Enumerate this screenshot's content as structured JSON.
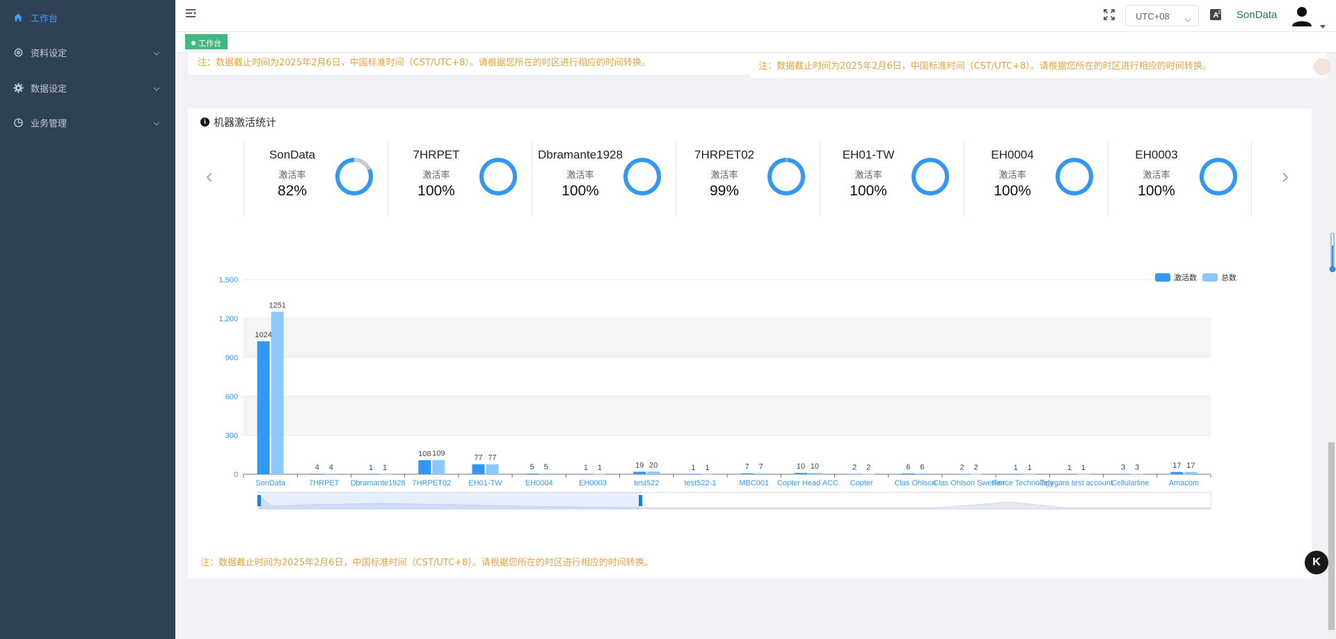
{
  "sidebar": {
    "items": [
      {
        "label": "工作台",
        "icon": "home-icon",
        "active": true
      },
      {
        "label": "资料设定",
        "icon": "settings-icon"
      },
      {
        "label": "数据设定",
        "icon": "gear-icon"
      },
      {
        "label": "业务管理",
        "icon": "pie-chart-icon"
      }
    ]
  },
  "header": {
    "timezone": "UTC+08",
    "username": "SonData"
  },
  "tags": {
    "active": "工作台"
  },
  "notes": {
    "text": "注：数据截止时间为2025年2月6日，中国标准时间（CST/UTC+8）。请根据您所在的时区进行相应的时间转换。"
  },
  "activation": {
    "title": "机器激活统计",
    "rate_label": "激活率",
    "cards": [
      {
        "name": "SonData",
        "value": "82%",
        "rate": 0.82
      },
      {
        "name": "7HRPET",
        "value": "100%",
        "rate": 1.0
      },
      {
        "name": "Dbramante1928",
        "value": "100%",
        "rate": 1.0
      },
      {
        "name": "7HRPET02",
        "value": "99%",
        "rate": 0.99
      },
      {
        "name": "EH01-TW",
        "value": "100%",
        "rate": 1.0
      },
      {
        "name": "EH0004",
        "value": "100%",
        "rate": 1.0
      },
      {
        "name": "EH0003",
        "value": "100%",
        "rate": 1.0
      }
    ]
  },
  "colors": {
    "activated": "#3398f3",
    "total": "#8cc8fa",
    "ring_bg": "#c8ccd2",
    "note": "#e6a23c",
    "accent": "#409eff",
    "tag": "#42b983"
  },
  "chart_data": {
    "type": "bar",
    "categories": [
      "SonData",
      "7HRPET",
      "Dbramante1928",
      "7HRPET02",
      "EH01-TW",
      "EH0004",
      "EH0003",
      "test522",
      "test522-1",
      "MBC001",
      "Copter Head ACC",
      "Copter",
      "Clas Ohlson",
      "Clas Ohlson Sweden",
      "Fierce Technology",
      "Telegare test account",
      "Cellularline",
      "Amacom"
    ],
    "series": [
      {
        "name": "激活数",
        "values": [
          1024,
          4,
          1,
          108,
          77,
          5,
          1,
          19,
          1,
          7,
          10,
          2,
          6,
          2,
          1,
          1,
          3,
          17
        ]
      },
      {
        "name": "总数",
        "values": [
          1251,
          4,
          1,
          109,
          77,
          5,
          1,
          20,
          1,
          7,
          10,
          2,
          6,
          2,
          1,
          1,
          3,
          17
        ]
      }
    ],
    "yticks": [
      "0",
      "300",
      "600",
      "900",
      "1,200",
      "1,500"
    ],
    "ylim": [
      0,
      1500
    ],
    "legend": "top-right",
    "grid": true,
    "datazoom": true
  }
}
